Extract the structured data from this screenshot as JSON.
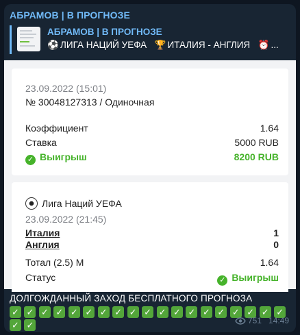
{
  "message": {
    "author": "АБРАМОВ | В ПРОГНОЗЕ",
    "reply": {
      "title": "АБРАМОВ | В ПРОГНОЗЕ",
      "items": [
        {
          "icon": "soccer-ball-icon",
          "glyph": "⚽",
          "text": "ЛИГА НАЦИЙ УЕФА"
        },
        {
          "icon": "trophy-icon",
          "glyph": "🏆",
          "text": "ИТАЛИЯ - АНГЛИЯ"
        },
        {
          "icon": "alarm-clock-icon",
          "glyph": "⏰",
          "text": "..."
        }
      ]
    },
    "text": "ДОЛГОЖДАННЫЙ ЗАХОД БЕСПЛАТНОГО ПРОГНОЗА",
    "check_emoji_count": 21,
    "views": "751",
    "time": "14:49"
  },
  "screenshot": {
    "bet": {
      "datetime": "23.09.2022 (15:01)",
      "number": "№ 30048127313 / Одиночная",
      "coef_label": "Коэффициент",
      "coef_value": "1.64",
      "stake_label": "Ставка",
      "stake_value": "5000 RUB",
      "result_label": "Выигрыш",
      "result_value": "8200 RUB"
    },
    "event": {
      "league": "Лига Наций УЕФА",
      "datetime": "23.09.2022 (21:45)",
      "team1": "Италия",
      "score1": "1",
      "team2": "Англия",
      "score2": "0",
      "market_label": "Тотал (2.5) М",
      "market_value": "1.64",
      "status_label": "Статус",
      "status_value": "Выигрыш"
    }
  },
  "colors": {
    "background": "#0e1621",
    "bubble": "#182533",
    "accent": "#71baf8",
    "win_green": "#46b32b"
  }
}
